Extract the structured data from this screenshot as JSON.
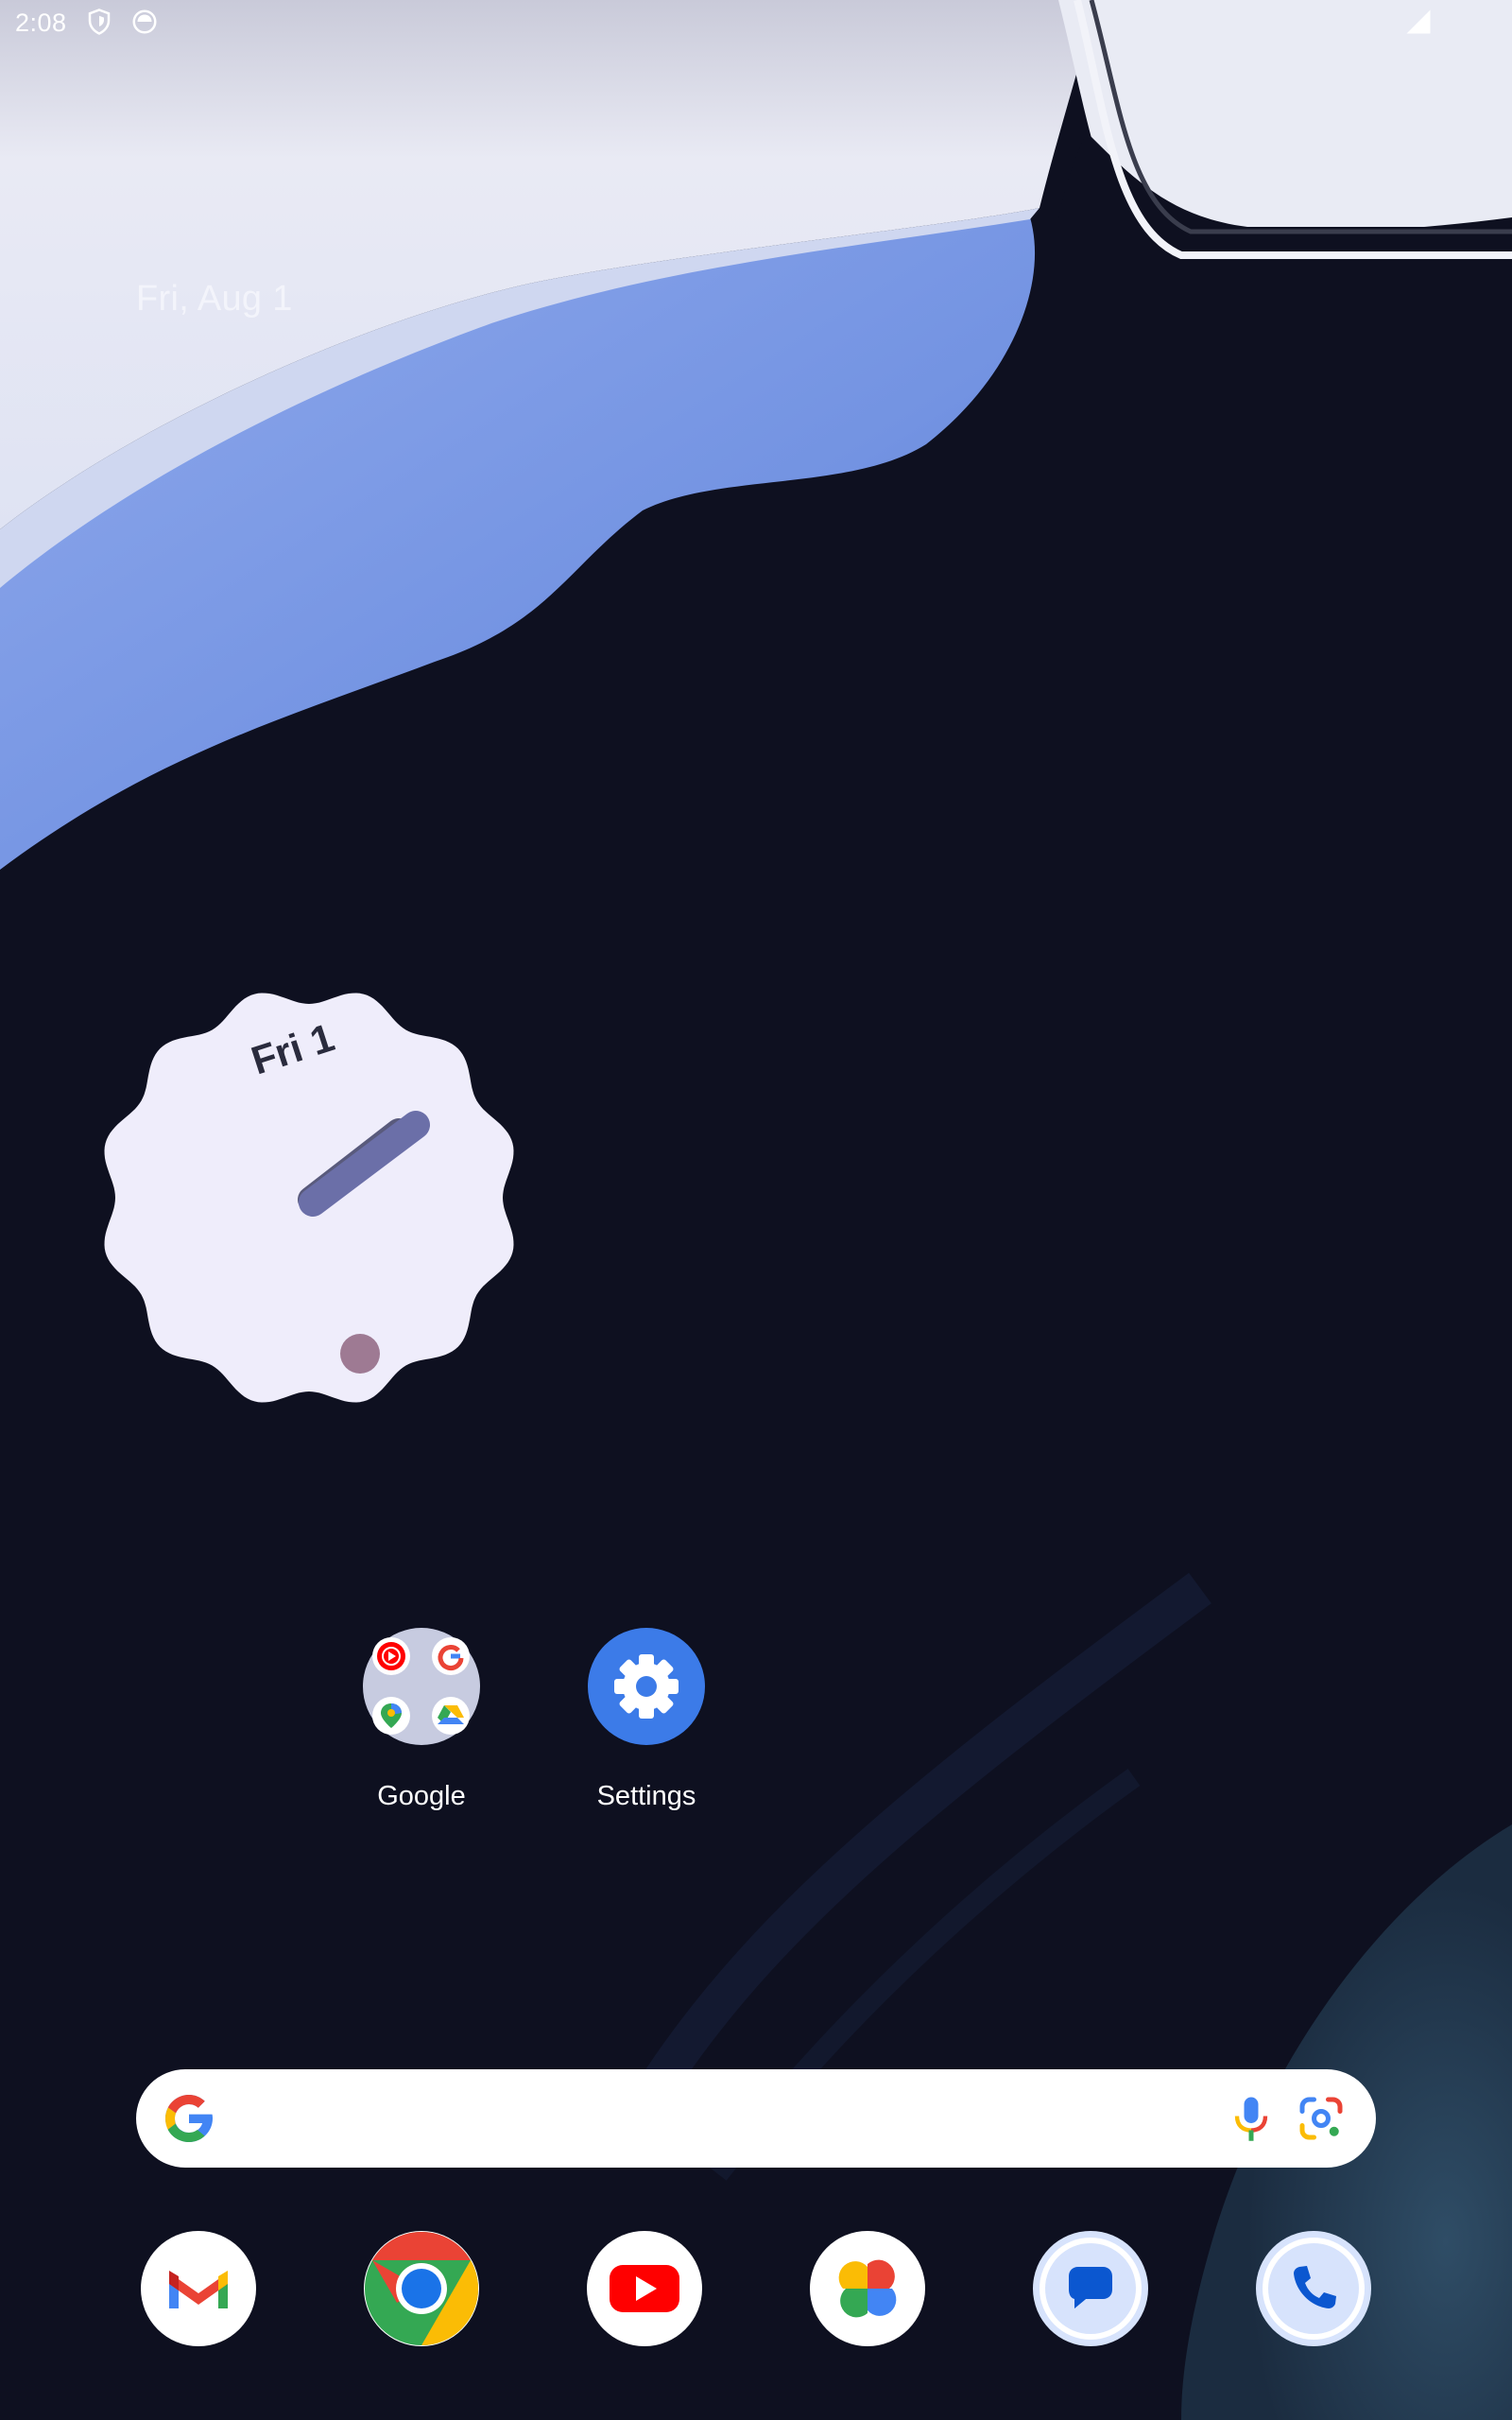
{
  "status_bar": {
    "time": "2:08",
    "left_icons": [
      "shield-icon",
      "notification-face-icon"
    ],
    "right_icons": [
      "cell-signal-icon"
    ]
  },
  "at_a_glance": {
    "date": "Fri, Aug 1"
  },
  "clock_widget": {
    "date_label": "Fri 1",
    "face_color": "#efedfb",
    "hand_color": "#6b6fa8",
    "dot_color": "#9e7a93"
  },
  "home_apps": [
    {
      "label": "Google",
      "icon": "folder-icon"
    },
    {
      "label": "Settings",
      "icon": "settings-gear-icon"
    }
  ],
  "search_bar": {
    "value": "",
    "placeholder": "",
    "icons": [
      "google-g-icon",
      "microphone-icon",
      "google-lens-icon"
    ]
  },
  "dock": [
    {
      "app": "Gmail",
      "icon": "gmail-icon"
    },
    {
      "app": "Chrome",
      "icon": "chrome-icon"
    },
    {
      "app": "YouTube",
      "icon": "youtube-icon"
    },
    {
      "app": "Photos",
      "icon": "photos-icon"
    },
    {
      "app": "Messages",
      "icon": "messages-icon"
    },
    {
      "app": "Phone",
      "icon": "phone-icon"
    }
  ],
  "colors": {
    "background": "#0e1020",
    "wallpaper_light": "#e6e8f5",
    "wallpaper_blue": "#7f9fe6",
    "google_blue": "#4285f4",
    "google_red": "#ea4335",
    "google_yellow": "#fbbc05",
    "google_green": "#34a853"
  }
}
